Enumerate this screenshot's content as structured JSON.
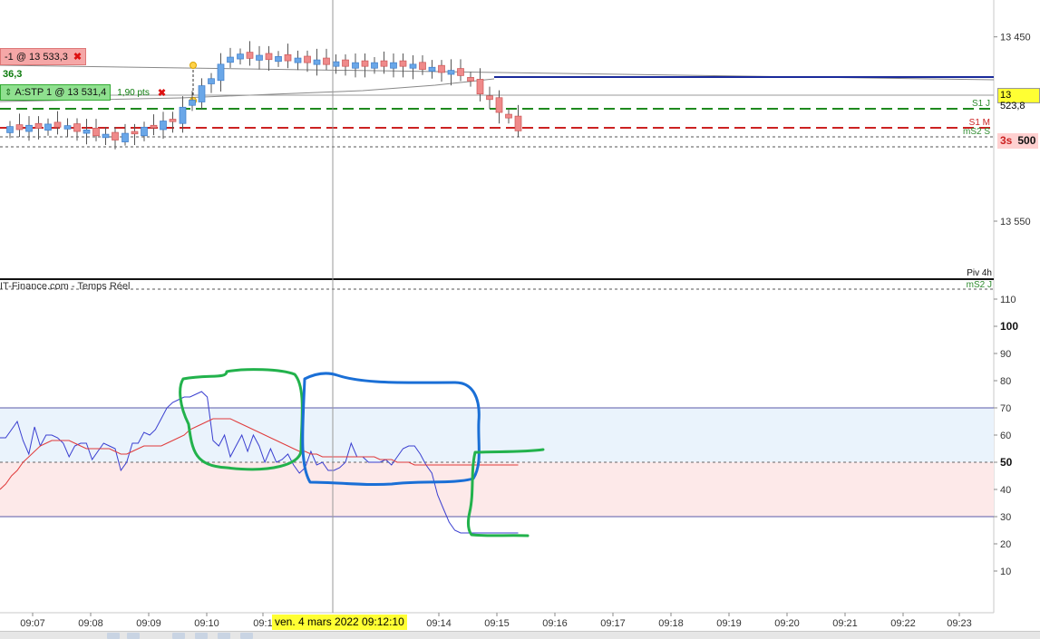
{
  "orders": {
    "limit_order": "-1 @ 13 533,3",
    "position_pnl": "36,3",
    "stop_order": "A:STP 1 @ 13 531,4",
    "stop_distance": "1,90 pts",
    "close_symbol": "✖"
  },
  "price_panel": {
    "current_price_tag": "13 523,8",
    "timer_label": "3s",
    "timer_value": "500",
    "levels": [
      {
        "label": "S1 J",
        "color": "#2e8b2e"
      },
      {
        "label": "S1 M",
        "color": "#cc2222"
      },
      {
        "label": "mS2 S",
        "color": "#2e8b2e"
      },
      {
        "label": "Piv 4h",
        "color": "#111111"
      },
      {
        "label": "mS2 J",
        "color": "#2e8b2e"
      }
    ],
    "axis_ticks": [
      13550,
      13450
    ],
    "axis_tick_labels": [
      "13 550",
      "13 450"
    ]
  },
  "indicator_panel": {
    "source": "IT-Finance.com - Temps Réel",
    "axis_ticks": [
      110,
      100,
      90,
      80,
      70,
      60,
      50,
      40,
      30,
      20,
      10
    ],
    "bold_ticks": [
      100,
      50
    ]
  },
  "time_axis": {
    "labels": [
      "09:07",
      "09:08",
      "09:09",
      "09:10",
      "09:1",
      "09:14",
      "09:15",
      "09:16",
      "09:17",
      "09:18",
      "09:19",
      "09:20",
      "09:21",
      "09:22",
      "09:23"
    ],
    "cursor_label": "ven. 4 mars 2022 09:12:10"
  },
  "colors": {
    "bull_candle": "#6aa7e8",
    "bear_candle": "#ef8a8a",
    "rsi_line": "#3a3fd0",
    "signal_line": "#e03a3a",
    "overbought_zone": "#eaf3fc",
    "oversold_zone": "#fde9e9",
    "annotation_green": "#22b24c",
    "annotation_blue": "#1a6fd6"
  },
  "chart_data": [
    {
      "type": "candlestick",
      "x": [
        "09:07",
        "09:08",
        "09:09",
        "09:10",
        "09:11",
        "09:12",
        "09:13",
        "09:14",
        "09:15"
      ],
      "open": [
        13500,
        13502,
        13495,
        13505,
        13540,
        13538,
        13535,
        13535,
        13530
      ],
      "close": [
        13502,
        13495,
        13505,
        13540,
        13538,
        13535,
        13535,
        13530,
        13500
      ],
      "high": [
        13508,
        13508,
        13510,
        13548,
        13557,
        13545,
        13540,
        13538,
        13532
      ],
      "low": [
        13494,
        13488,
        13493,
        13500,
        13525,
        13520,
        13522,
        13525,
        13498
      ],
      "ylim": [
        13420,
        13570
      ],
      "yticks": [
        13450,
        13550
      ]
    },
    {
      "type": "line",
      "ylim": [
        0,
        110
      ],
      "yticks": [
        10,
        20,
        30,
        40,
        50,
        60,
        70,
        80,
        90,
        100,
        110
      ],
      "x": [
        0,
        1,
        2,
        3,
        4,
        5,
        6,
        7,
        8,
        9,
        10,
        11,
        12,
        13,
        14,
        15,
        16,
        17,
        18,
        19,
        20,
        21,
        22,
        23,
        24,
        25,
        26,
        27,
        28,
        29,
        30,
        31,
        32,
        33,
        34,
        35,
        36,
        37,
        38,
        39,
        40,
        41,
        42,
        43,
        44,
        45,
        46,
        47,
        48,
        49,
        50,
        51,
        52,
        53,
        54,
        55,
        56,
        57,
        58,
        59,
        60,
        61,
        62,
        63,
        64,
        65,
        66,
        67,
        68,
        69,
        70,
        71,
        72,
        73,
        74,
        75,
        76,
        77,
        78,
        79,
        80,
        81,
        82,
        83,
        84,
        85,
        86,
        87,
        88,
        89,
        90
      ],
      "series": [
        {
          "values": [
            59,
            59,
            62,
            65,
            58,
            53,
            63,
            56,
            60,
            60,
            59,
            57,
            52,
            56,
            57,
            57,
            51,
            54,
            57,
            56,
            55,
            47,
            50,
            57,
            57,
            61,
            60,
            62,
            66,
            70,
            72,
            73,
            74,
            74,
            75,
            76,
            74,
            58,
            56,
            60,
            52,
            56,
            60,
            54,
            60,
            56,
            50,
            55,
            50,
            51,
            53,
            49,
            46,
            48,
            54,
            49,
            50,
            47,
            47,
            48,
            50,
            57,
            52,
            52,
            50,
            50,
            50,
            51,
            49,
            52,
            55,
            56,
            56,
            53,
            49,
            46,
            38,
            33,
            28,
            25,
            24,
            24,
            24,
            24,
            24,
            24,
            24,
            24,
            24,
            24,
            24
          ]
        },
        {
          "values": [
            40,
            42,
            45,
            47,
            50,
            52,
            54,
            56,
            57,
            58,
            58,
            58,
            58,
            57,
            56,
            55,
            55,
            55,
            55,
            55,
            54,
            53,
            53,
            54,
            55,
            56,
            56,
            56,
            56,
            57,
            58,
            59,
            60,
            62,
            63,
            64,
            65,
            66,
            66,
            66,
            66,
            65,
            64,
            63,
            62,
            61,
            60,
            59,
            58,
            57,
            56,
            55,
            54,
            54,
            53,
            53,
            52,
            52,
            52,
            52,
            52,
            52,
            52,
            52,
            52,
            52,
            51,
            51,
            51,
            50,
            50,
            50,
            49,
            49,
            49,
            49,
            49,
            49,
            49,
            49,
            49,
            49,
            49,
            49,
            49,
            49,
            49,
            49,
            49,
            49,
            49
          ]
        }
      ],
      "zones": [
        [
          50,
          70
        ],
        [
          30,
          50
        ]
      ]
    }
  ]
}
